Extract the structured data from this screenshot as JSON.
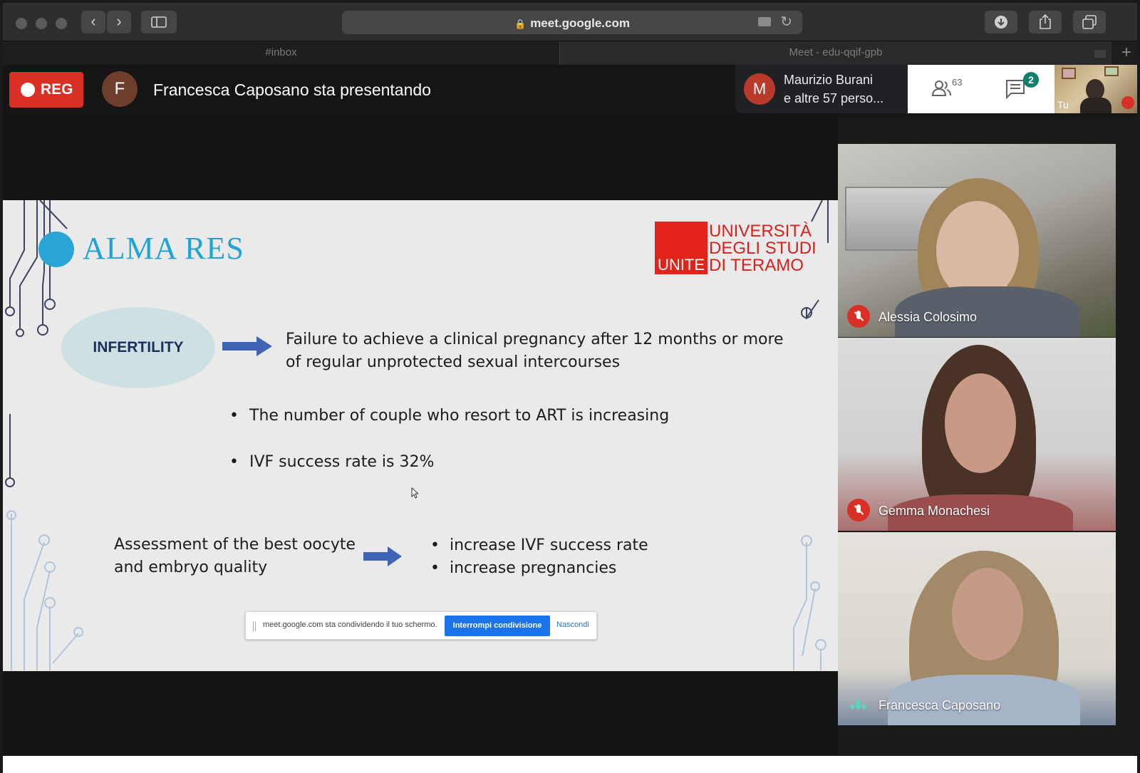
{
  "browser": {
    "url": "meet.google.com",
    "tabs": [
      {
        "label": "#inbox"
      },
      {
        "label": "Meet - edu-qqif-gpb"
      }
    ]
  },
  "meet": {
    "rec_label": "REG",
    "presenter_initial": "F",
    "presenting_text": "Francesca Caposano sta presentando",
    "participant_initial": "M",
    "participant_name": "Maurizio Burani",
    "participant_more": "e altre 57 perso...",
    "people_count": "63",
    "chat_badge": "2",
    "self_label": "Tu"
  },
  "slide": {
    "logo_text": "ALMA RES",
    "uni_line1": "UNIVERSITÀ",
    "uni_line2": "DEGLI STUDI",
    "uni_line3": "DI TERAMO",
    "unite": "UNITE",
    "infertility": "INFERTILITY",
    "definition_line1": "Failure to achieve a clinical pregnancy after 12 months or more",
    "definition_line2": "of regular unprotected sexual intercourses",
    "bullet1": "The number of couple who resort to ART is increasing",
    "bullet2": "IVF success rate is 32%",
    "assessment_line1": "Assessment of the best oocyte",
    "assessment_line2": "and embryo quality",
    "outcome1": "increase IVF success rate",
    "outcome2": "increase pregnancies"
  },
  "sharebar": {
    "message": "meet.google.com sta condividendo il tuo schermo.",
    "stop_label": "Interrompi condivisione",
    "hide_label": "Nascondi"
  },
  "tiles": [
    {
      "name": "Alessia Colosimo",
      "muted": true
    },
    {
      "name": "Gemma Monachesi",
      "muted": true
    },
    {
      "name": "Francesca Caposano",
      "muted": false
    }
  ],
  "colors": {
    "rec": "#d93025",
    "accent_blue": "#1a73e8",
    "chat_badge": "#137e6c",
    "alma_blue": "#1fa4d4",
    "unite_red": "#e2231a"
  }
}
